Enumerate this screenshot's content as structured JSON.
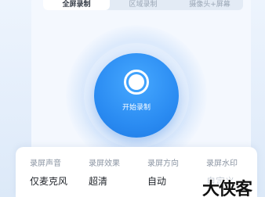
{
  "tabs": [
    {
      "label": "全屏录制",
      "active": true
    },
    {
      "label": "区域录制",
      "active": false
    },
    {
      "label": "摄像头+屏幕",
      "active": false
    }
  ],
  "record_button": {
    "label": "开始录制"
  },
  "settings": [
    {
      "label": "录屏声音",
      "value": "仅麦克风"
    },
    {
      "label": "录屏效果",
      "value": "超清"
    },
    {
      "label": "录屏方向",
      "value": "自动"
    },
    {
      "label": "录屏水印",
      "value": "自定义"
    }
  ],
  "watermark": "大侠客",
  "colors": {
    "accent": "#2b8cf2",
    "background": "#e8f1fc",
    "card": "#ffffff"
  }
}
